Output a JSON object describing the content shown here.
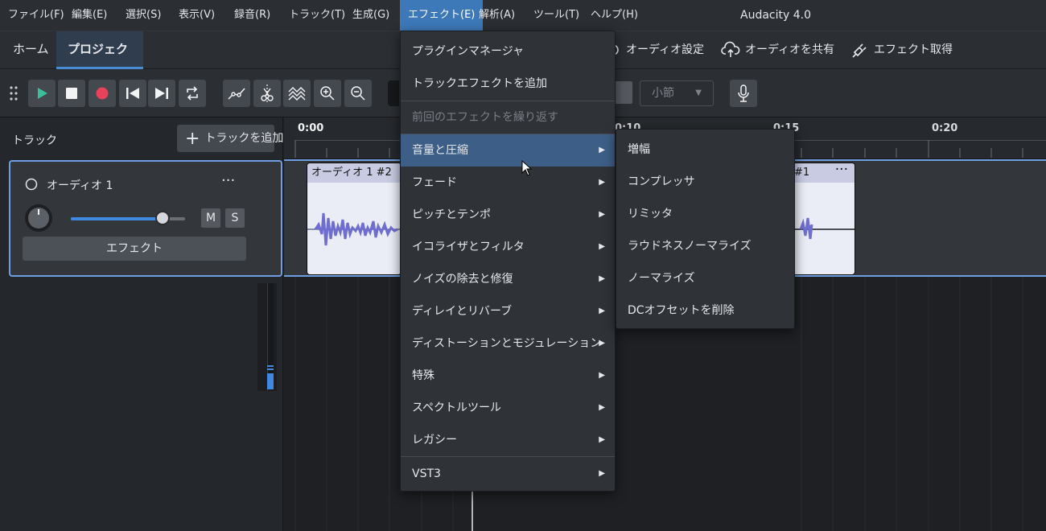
{
  "app_title": "Audacity 4.0",
  "menubar": [
    {
      "label": "ファイル(F)"
    },
    {
      "label": "編集(E)"
    },
    {
      "label": "選択(S)"
    },
    {
      "label": "表示(V)"
    },
    {
      "label": "録音(R)"
    },
    {
      "label": "トラック(T)"
    },
    {
      "label": "生成(G)"
    },
    {
      "label": "エフェクト(E)",
      "active": true
    },
    {
      "label": "解析(A)"
    },
    {
      "label": "ツール(T)"
    },
    {
      "label": "ヘルプ(H)"
    }
  ],
  "nav": {
    "tabs": [
      {
        "label": "ホーム"
      },
      {
        "label": "プロジェクト",
        "active": true
      }
    ],
    "actions": [
      {
        "label": "オーディオ設定",
        "icon": "gear-icon"
      },
      {
        "label": "オーディオを共有",
        "icon": "cloud-share-icon"
      },
      {
        "label": "エフェクト取得",
        "icon": "plug-icon"
      }
    ]
  },
  "toolbar": {
    "snap_select": "小節",
    "colors": {
      "play": "#3bbf9a",
      "record": "#e8415c"
    }
  },
  "tracks_panel": {
    "label": "トラック",
    "add_track": "トラックを追加",
    "track": {
      "name": "オーディオ 1",
      "more": "···",
      "mute": "M",
      "solo": "S",
      "effects_button": "エフェクト",
      "volume_level": 0.8
    }
  },
  "ruler": {
    "ticks": [
      "0:00",
      "0:10",
      "0:15",
      "0:20"
    ]
  },
  "clips": [
    {
      "name": "オーディオ 1 #2"
    },
    {
      "name": "#1",
      "more": "···"
    }
  ],
  "effect_menu": {
    "items": [
      {
        "label": "プラグインマネージャ"
      },
      {
        "label": "トラックエフェクトを追加"
      },
      {
        "label": "前回のエフェクトを繰り返す",
        "disabled": true
      },
      {
        "label": "音量と圧縮",
        "submenu": true,
        "highlighted": true
      },
      {
        "label": "フェード",
        "submenu": true
      },
      {
        "label": "ピッチとテンポ",
        "submenu": true
      },
      {
        "label": "イコライザとフィルタ",
        "submenu": true
      },
      {
        "label": "ノイズの除去と修復",
        "submenu": true
      },
      {
        "label": "ディレイとリバーブ",
        "submenu": true
      },
      {
        "label": "ディストーションとモジュレーション",
        "submenu": true
      },
      {
        "label": "特殊",
        "submenu": true
      },
      {
        "label": "スペクトルツール",
        "submenu": true
      },
      {
        "label": "レガシー",
        "submenu": true
      },
      {
        "label": "VST3",
        "submenu": true
      }
    ]
  },
  "volume_submenu": {
    "items": [
      {
        "label": "増幅"
      },
      {
        "label": "コンプレッサ"
      },
      {
        "label": "リミッタ"
      },
      {
        "label": "ラウドネスノーマライズ"
      },
      {
        "label": "ノーマライズ"
      },
      {
        "label": "DCオフセットを削除"
      }
    ]
  }
}
